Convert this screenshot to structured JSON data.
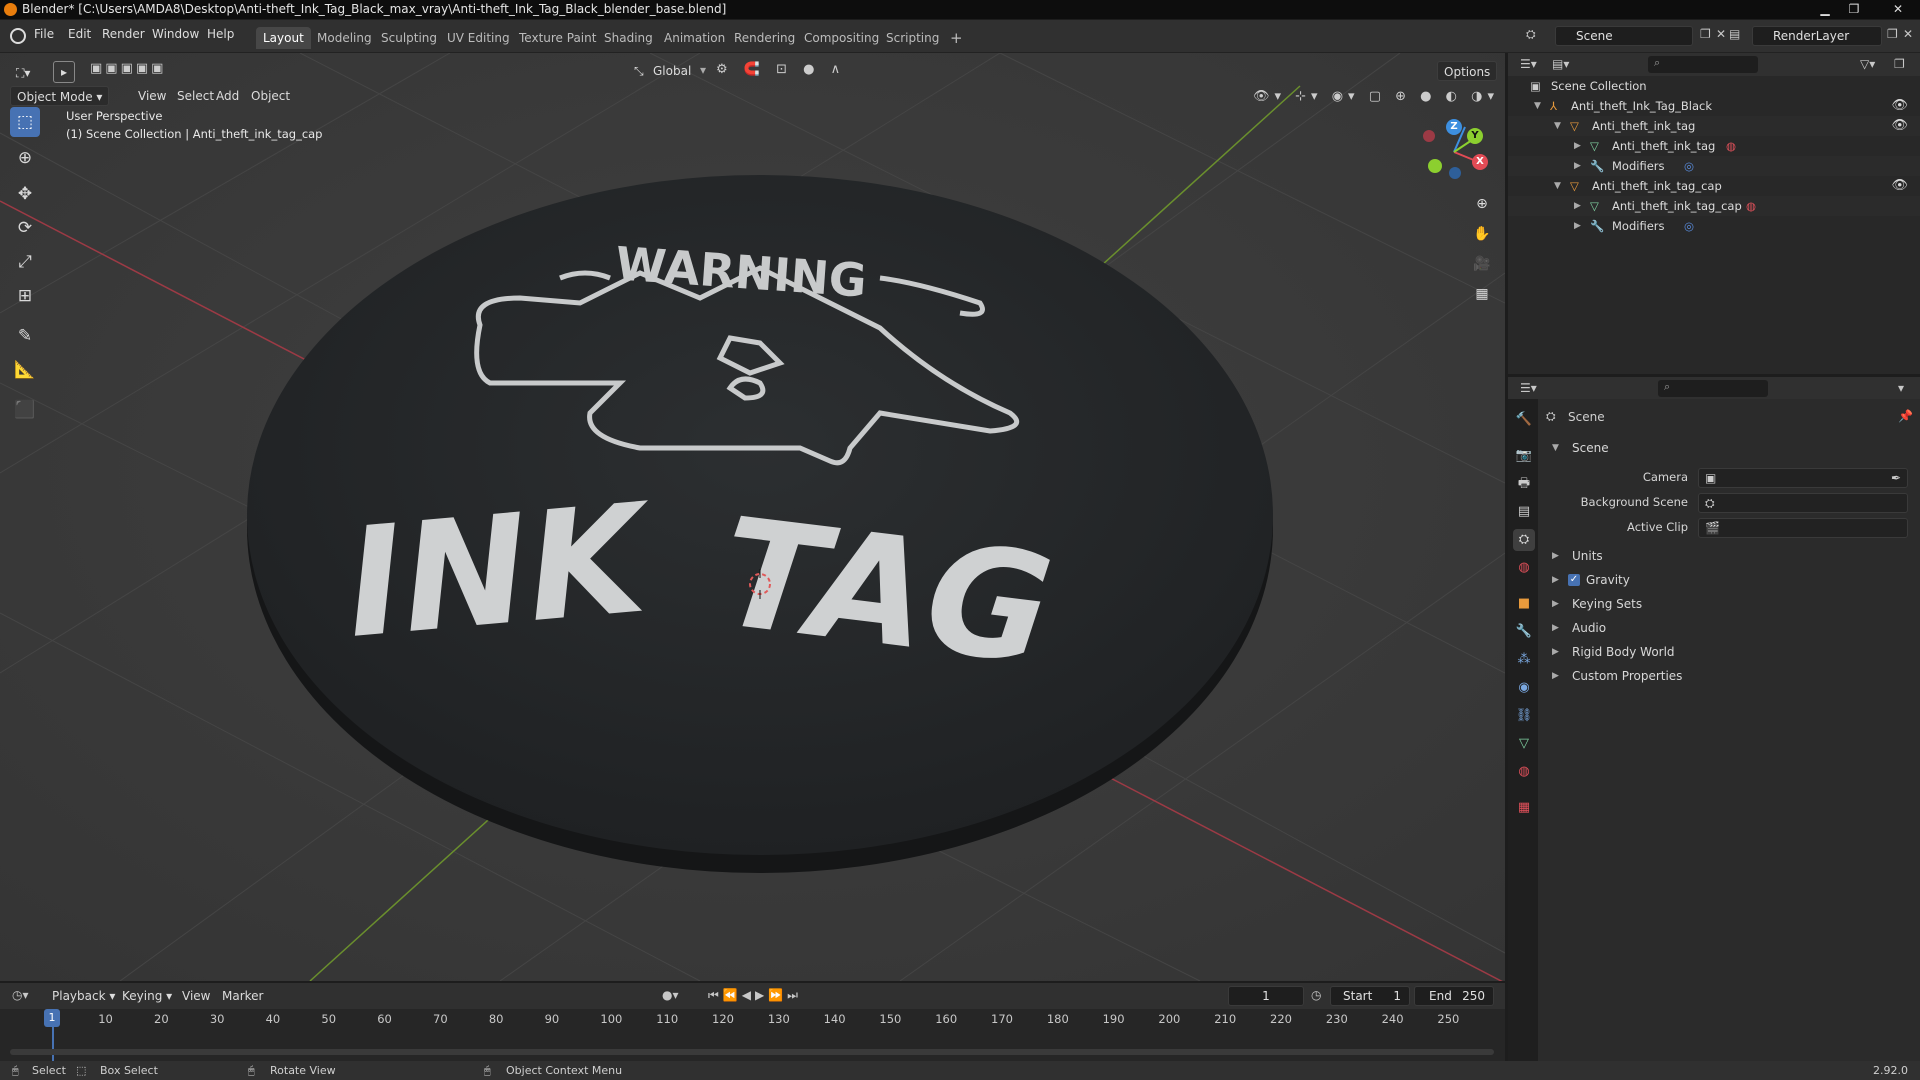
{
  "title_bar": {
    "text": "Blender* [C:\\Users\\AMDA8\\Desktop\\Anti-theft_Ink_Tag_Black_max_vray\\Anti-theft_Ink_Tag_Black_blender_base.blend]",
    "minimize": "▁",
    "maximize": "❐",
    "close": "✕"
  },
  "menu": [
    "File",
    "Edit",
    "Render",
    "Window",
    "Help"
  ],
  "workspaces": [
    "Layout",
    "Modeling",
    "Sculpting",
    "UV Editing",
    "Texture Paint",
    "Shading",
    "Animation",
    "Rendering",
    "Compositing",
    "Scripting"
  ],
  "active_workspace": "Layout",
  "add_workspace": "+",
  "scene_field": "Scene",
  "renderlayer_field": "RenderLayer",
  "viewport": {
    "mode": "Object Mode",
    "menus": [
      "View",
      "Select",
      "Add",
      "Object"
    ],
    "transform_orientation": "Global",
    "options": "Options",
    "perspective_label": "User Perspective",
    "collection_label": "(1) Scene Collection | Anti_theft_ink_tag_cap",
    "object_text_warning": "WARNING",
    "object_text_main_1": "INK",
    "object_text_main_2": "TAG",
    "gizmo": {
      "x": "X",
      "y": "Y",
      "z": "Z"
    }
  },
  "outliner": {
    "root": "Scene Collection",
    "items": [
      {
        "label": "Anti_theft_Ink_Tag_Black",
        "indent": 1
      },
      {
        "label": "Anti_theft_ink_tag",
        "indent": 2
      },
      {
        "label": "Anti_theft_ink_tag",
        "indent": 3
      },
      {
        "label": "Modifiers",
        "indent": 3
      },
      {
        "label": "Anti_theft_ink_tag_cap",
        "indent": 2
      },
      {
        "label": "Anti_theft_ink_tag_cap",
        "indent": 3
      },
      {
        "label": "Modifiers",
        "indent": 3
      }
    ]
  },
  "properties": {
    "context": "Scene",
    "section": "Scene",
    "fields": {
      "camera": "Camera",
      "background_scene": "Background Scene",
      "active_clip": "Active Clip"
    },
    "panels": [
      "Units",
      "Gravity",
      "Keying Sets",
      "Audio",
      "Rigid Body World",
      "Custom Properties"
    ],
    "gravity_checked": true
  },
  "timeline": {
    "menus": [
      "Playback",
      "Keying",
      "View",
      "Marker"
    ],
    "current_frame": "1",
    "start_label": "Start",
    "start": "1",
    "end_label": "End",
    "end": "250",
    "ticks": [
      "1",
      "10",
      "20",
      "30",
      "40",
      "50",
      "60",
      "70",
      "80",
      "90",
      "100",
      "110",
      "120",
      "130",
      "140",
      "150",
      "160",
      "170",
      "180",
      "190",
      "200",
      "210",
      "220",
      "230",
      "240",
      "250"
    ]
  },
  "statusbar": {
    "select": "Select",
    "box_select": "Box Select",
    "rotate_view": "Rotate View",
    "context_menu": "Object Context Menu",
    "version": "2.92.0"
  },
  "colors": {
    "accent": "#4772b3",
    "x_axis": "#e24b55",
    "y_axis": "#8ccf2f",
    "z_axis": "#3d8fe0",
    "object": "#222425",
    "label": "#e8e8e8"
  }
}
